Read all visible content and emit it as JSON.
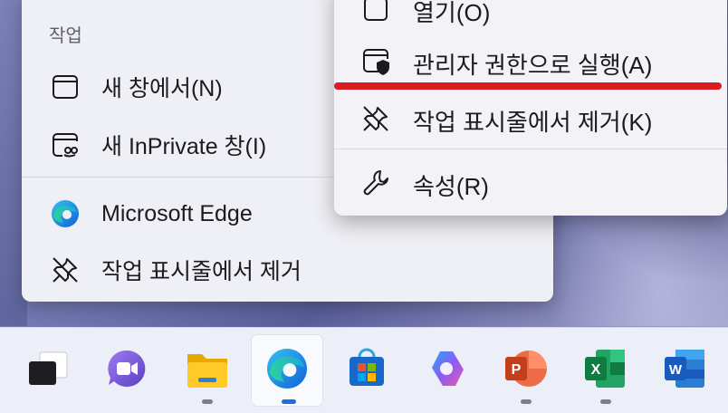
{
  "jump_list": {
    "section_label": "작업",
    "items": [
      {
        "label": "새 창에서(N)",
        "icon": "window-icon"
      },
      {
        "label": "새 InPrivate 창(I)",
        "icon": "inprivate-window-icon"
      },
      {
        "label": "Microsoft Edge",
        "icon": "edge-icon"
      },
      {
        "label": "작업 표시줄에서 제거",
        "icon": "unpin-icon"
      }
    ]
  },
  "context_menu": {
    "items": [
      {
        "label": "열기(O)",
        "icon": "open-window-icon"
      },
      {
        "label": "관리자 권한으로 실행(A)",
        "icon": "admin-shield-icon"
      },
      {
        "label": "작업 표시줄에서 제거(K)",
        "icon": "unpin-icon"
      },
      {
        "label": "속성(R)",
        "icon": "wrench-icon"
      }
    ],
    "highlight_color": "#d91c24"
  },
  "taskbar": {
    "apps": [
      {
        "name": "task-view",
        "icon": "task-view-icon",
        "running": false,
        "active": false
      },
      {
        "name": "teams",
        "icon": "teams-icon",
        "running": false,
        "active": false
      },
      {
        "name": "file-explorer",
        "icon": "folder-icon",
        "running": true,
        "active": false
      },
      {
        "name": "edge",
        "icon": "edge-icon",
        "running": true,
        "active": true
      },
      {
        "name": "store",
        "icon": "store-icon",
        "running": false,
        "active": false
      },
      {
        "name": "copilot",
        "icon": "copilot-icon",
        "running": false,
        "active": false
      },
      {
        "name": "powerpoint",
        "icon": "powerpoint-icon",
        "running": true,
        "active": false
      },
      {
        "name": "excel",
        "icon": "excel-icon",
        "running": true,
        "active": false
      },
      {
        "name": "word",
        "icon": "word-icon",
        "running": false,
        "active": false
      }
    ]
  }
}
